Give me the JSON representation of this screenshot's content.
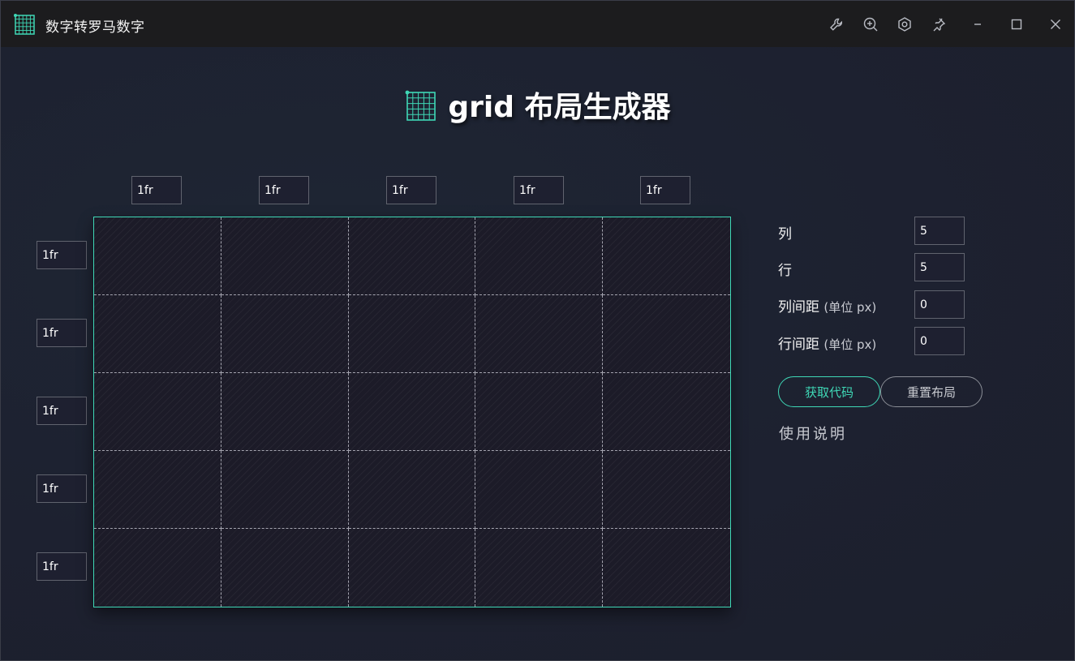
{
  "window": {
    "title": "数字转罗马数字",
    "controls": [
      "wrench-icon",
      "zoom-in-icon",
      "settings-icon",
      "pin-icon",
      "minimize-icon",
      "maximize-icon",
      "close-icon"
    ]
  },
  "page": {
    "heading": "grid 布局生成器"
  },
  "columns": [
    "1fr",
    "1fr",
    "1fr",
    "1fr",
    "1fr"
  ],
  "rows": [
    "1fr",
    "1fr",
    "1fr",
    "1fr",
    "1fr"
  ],
  "controls": {
    "columns_label": "列",
    "columns_value": "5",
    "rows_label": "行",
    "rows_value": "5",
    "col_gap_label": "列间距",
    "col_gap_unit": "(单位 px)",
    "col_gap_value": "0",
    "row_gap_label": "行间距",
    "row_gap_unit": "(单位 px)",
    "row_gap_value": "0"
  },
  "buttons": {
    "get_code": "获取代码",
    "reset": "重置布局"
  },
  "help": {
    "label": "使用说明"
  },
  "colors": {
    "accent": "#3fd8b6",
    "titlebar": "#1c1c1e",
    "background": "#1d2130"
  }
}
